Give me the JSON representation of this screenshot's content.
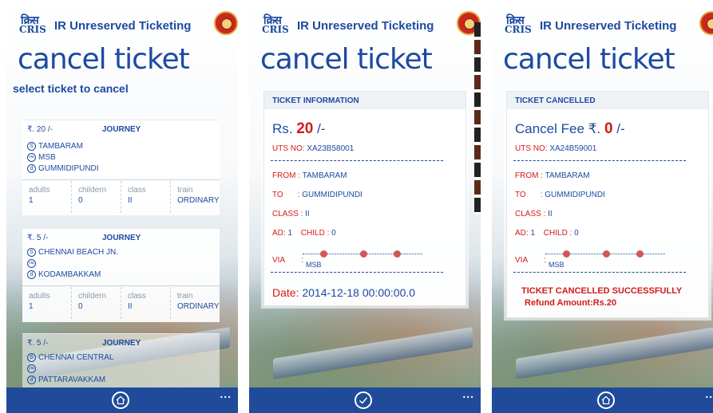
{
  "header": {
    "cris_logo_text": "CRIS",
    "cris_logo_glyph": "क्रिस",
    "app_title": "IR Unreserved Ticketing"
  },
  "screens": [
    {
      "page_title": "cancel ticket",
      "subtitle": "select ticket to cancel",
      "tickets": [
        {
          "fare": "₹. 20 /-",
          "journey_label": "JOURNEY",
          "source": "TAMBARAM",
          "via": "MSB",
          "destination": "GUMMIDIPUNDI",
          "columns": [
            {
              "header": "adults",
              "value": "1"
            },
            {
              "header": "childern",
              "value": "0"
            },
            {
              "header": "class",
              "value": "II"
            },
            {
              "header": "train",
              "value": "ORDINARY"
            }
          ]
        },
        {
          "fare": "₹. 5 /-",
          "journey_label": "JOURNEY",
          "source": "CHENNAI BEACH JN.",
          "via": "",
          "destination": "KODAMBAKKAM",
          "columns": [
            {
              "header": "adults",
              "value": "1"
            },
            {
              "header": "childern",
              "value": "0"
            },
            {
              "header": "class",
              "value": "II"
            },
            {
              "header": "train",
              "value": "ORDINARY"
            }
          ]
        },
        {
          "fare": "₹. 5 /-",
          "journey_label": "JOURNEY",
          "source": "CHENNAI CENTRAL",
          "via": "",
          "destination": "PATTARAVAKKAM"
        }
      ],
      "icon_labels": {
        "source": "S",
        "via": "via",
        "destination": "d"
      }
    },
    {
      "page_title": "cancel ticket",
      "panel_header": "TICKET INFORMATION",
      "fare_prefix": "Rs.",
      "fare_amount": "20",
      "fare_suffix": "/-",
      "uts_label": "UTS NO:",
      "uts_value": "XA23B58001",
      "from_label": "FROM",
      "from_value": "TAMBARAM",
      "to_label": "TO",
      "to_value": "GUMMIDIPUNDI",
      "class_label": "CLASS",
      "class_value": "II",
      "ad_label": "AD:",
      "ad_value": "1",
      "child_label": "CHILD",
      "child_value": "0",
      "via_label": "VIA",
      "via_value": "MSB",
      "date_label": "Date:",
      "date_value": "2014-12-18 00:00:00.0"
    },
    {
      "page_title": "cancel ticket",
      "panel_header": "TICKET CANCELLED",
      "fee_prefix": "Cancel Fee ₹.",
      "fee_amount": "0",
      "fee_suffix": "/-",
      "uts_label": "UTS NO:",
      "uts_value": "XA24B59001",
      "from_label": "FROM",
      "from_value": "TAMBARAM",
      "to_label": "TO",
      "to_value": "GUMMIDIPUNDI",
      "class_label": "CLASS",
      "class_value": "II",
      "ad_label": "AD:",
      "ad_value": "1",
      "child_label": "CHILD",
      "child_value": "0",
      "via_label": "VIA",
      "via_value": "MSB",
      "status_message": "TICKET CANCELLED SUCCESSFULLY",
      "refund_text": "Refund Amount:Rs.20"
    }
  ],
  "appbar": {
    "more_label": "...",
    "home_icon": "home-icon",
    "confirm_icon": "check-icon"
  },
  "colors": {
    "brand_blue": "#1d4aa0",
    "appbar_blue": "#1f4b9a",
    "accent_red": "#d41a1a"
  }
}
